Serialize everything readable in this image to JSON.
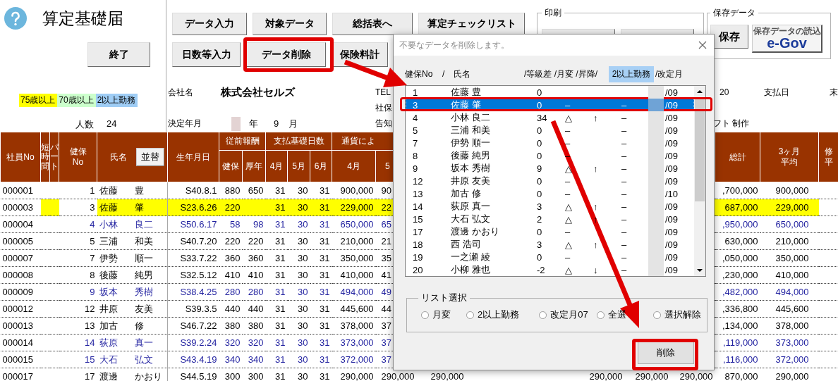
{
  "app": {
    "title": "算定基礎届",
    "exit_button": "終了",
    "legend": [
      {
        "label": "75歳以上",
        "color": "#ffff00"
      },
      {
        "label": "70歳以上",
        "color": "#ccffcc"
      },
      {
        "label": "2以上勤務",
        "color": "#9fcdf5"
      }
    ],
    "headcount_label": "人数",
    "headcount": "24"
  },
  "toolbar": {
    "rows": [
      [
        "データ入力",
        "対象データ",
        "総括表へ",
        "算定チェックリスト"
      ],
      [
        "日数等入力",
        "データ削除",
        "保険料計"
      ]
    ]
  },
  "print_group": {
    "title": "印刷"
  },
  "save_group": {
    "title": "保存データ",
    "save_button": "保存",
    "load_caption": "保存データの読込",
    "load_logo": "e-Gov"
  },
  "info": {
    "company_label": "会社名",
    "company_name": "株式会社セルズ",
    "tel_label": "TEL",
    "shaho_label": "社保",
    "decision_label": "決定年月",
    "year_label": "年",
    "month": "9",
    "month_label": "月",
    "notice_label": "告知",
    "column_20": "20",
    "payday_label": "支払日",
    "payday_value": "末",
    "credit": "フト 制作"
  },
  "table": {
    "leading_columns": [
      "社員No",
      "短時間",
      "パート",
      "健保\nNo",
      "氏名",
      "生年月日"
    ],
    "sort_button": "並替",
    "groups": [
      {
        "label": "従前報酬",
        "columns": [
          "健保",
          "厚年"
        ]
      },
      {
        "label": "支払基礎日数",
        "columns": [
          "4月",
          "5月",
          "6月"
        ]
      },
      {
        "label": "通貨によ",
        "columns": [
          "4月",
          "5"
        ]
      }
    ],
    "trailing_columns": [
      "総計",
      "3ヶ月平均",
      "修平"
    ],
    "rows": [
      {
        "employee_no": "000001",
        "kenpo_no": "1",
        "surname": "佐藤",
        "given_name": "豊",
        "birth_date": "S40.8.1",
        "prev_kenpo": "880",
        "prev_kounen": "650",
        "days_apr": "31",
        "days_may": "30",
        "days_jun": "31",
        "pay_apr": "900,000",
        "pay_may": "90",
        "total": ",700,000",
        "average": "900,000",
        "highlight": false,
        "color": "#000000"
      },
      {
        "employee_no": "000003",
        "kenpo_no": "3",
        "surname": "佐藤",
        "given_name": "肇",
        "birth_date": "S23.6.26",
        "prev_kenpo": "220",
        "days_apr": "31",
        "days_may": "30",
        "days_jun": "31",
        "pay_apr": "229,000",
        "pay_may": "22",
        "total": "687,000",
        "average": "229,000",
        "highlight": true,
        "color": "#000000"
      },
      {
        "employee_no": "000004",
        "kenpo_no": "4",
        "surname": "小林",
        "given_name": "良二",
        "birth_date": "S50.6.17",
        "prev_kenpo": "58",
        "prev_kounen": "98",
        "days_apr": "31",
        "days_may": "30",
        "days_jun": "31",
        "pay_apr": "650,000",
        "pay_may": "65",
        "total": ",950,000",
        "average": "650,000",
        "highlight": false,
        "color": "#1f1f9f"
      },
      {
        "employee_no": "000005",
        "kenpo_no": "5",
        "surname": "三浦",
        "given_name": "和美",
        "birth_date": "S40.7.20",
        "prev_kenpo": "220",
        "prev_kounen": "220",
        "days_apr": "31",
        "days_may": "30",
        "days_jun": "31",
        "pay_apr": "210,000",
        "pay_may": "21",
        "total": "630,000",
        "average": "210,000",
        "highlight": false,
        "color": "#000000"
      },
      {
        "employee_no": "000007",
        "kenpo_no": "7",
        "surname": "伊勢",
        "given_name": "順一",
        "birth_date": "S33.7.22",
        "prev_kenpo": "360",
        "prev_kounen": "360",
        "days_apr": "31",
        "days_may": "30",
        "days_jun": "31",
        "pay_apr": "350,000",
        "pay_may": "35",
        "total": ",050,000",
        "average": "350,000",
        "highlight": false,
        "color": "#000000"
      },
      {
        "employee_no": "000008",
        "kenpo_no": "8",
        "surname": "後藤",
        "given_name": "純男",
        "birth_date": "S32.5.12",
        "prev_kenpo": "410",
        "prev_kounen": "410",
        "days_apr": "31",
        "days_may": "30",
        "days_jun": "31",
        "pay_apr": "410,000",
        "pay_may": "41",
        "total": ",230,000",
        "average": "410,000",
        "highlight": false,
        "color": "#000000"
      },
      {
        "employee_no": "000009",
        "kenpo_no": "9",
        "surname": "坂本",
        "given_name": "秀樹",
        "birth_date": "S38.4.25",
        "prev_kenpo": "280",
        "prev_kounen": "280",
        "days_apr": "31",
        "days_may": "30",
        "days_jun": "31",
        "pay_apr": "494,000",
        "pay_may": "49",
        "total": ",482,000",
        "average": "494,000",
        "highlight": false,
        "color": "#1f1f9f"
      },
      {
        "employee_no": "000012",
        "kenpo_no": "12",
        "surname": "井原",
        "given_name": "友美",
        "birth_date": "S39.3.5",
        "prev_kenpo": "440",
        "prev_kounen": "440",
        "days_apr": "31",
        "days_may": "30",
        "days_jun": "31",
        "pay_apr": "445,600",
        "pay_may": "44",
        "total": ",336,800",
        "average": "445,600",
        "highlight": false,
        "color": "#000000"
      },
      {
        "employee_no": "000013",
        "kenpo_no": "13",
        "surname": "加古",
        "given_name": "修",
        "birth_date": "S46.7.22",
        "prev_kenpo": "380",
        "prev_kounen": "380",
        "days_apr": "31",
        "days_may": "30",
        "days_jun": "31",
        "pay_apr": "378,000",
        "pay_may": "37",
        "total": ",134,000",
        "average": "378,000",
        "highlight": false,
        "color": "#000000"
      },
      {
        "employee_no": "000014",
        "kenpo_no": "14",
        "surname": "荻原",
        "given_name": "真一",
        "birth_date": "S39.2.24",
        "prev_kenpo": "320",
        "prev_kounen": "320",
        "days_apr": "31",
        "days_may": "30",
        "days_jun": "31",
        "pay_apr": "373,000",
        "pay_may": "37",
        "total": ",119,000",
        "average": "373,000",
        "highlight": false,
        "color": "#1f1f9f"
      },
      {
        "employee_no": "000015",
        "kenpo_no": "15",
        "surname": "大石",
        "given_name": "弘文",
        "birth_date": "S43.4.19",
        "prev_kenpo": "340",
        "prev_kounen": "340",
        "days_apr": "31",
        "days_may": "30",
        "days_jun": "31",
        "pay_apr": "372,000",
        "pay_may": "37",
        "total": ",116,000",
        "average": "372,000",
        "highlight": false,
        "color": "#1f1f9f"
      },
      {
        "employee_no": "000017",
        "kenpo_no": "17",
        "surname": "渡邊",
        "given_name": "かおり",
        "birth_date": "S44.5.19",
        "prev_kenpo": "300",
        "prev_kounen": "300",
        "days_apr": "31",
        "days_may": "30",
        "days_jun": "31",
        "pay_apr": "290,000",
        "pay_may": "290,000",
        "pay_jun": "290,000",
        "column_16": "290,000",
        "column_17": "290,000",
        "column_18": "290,000",
        "total": "870,000",
        "average": "290,000",
        "highlight": false,
        "color": "#000000"
      }
    ]
  },
  "dialog": {
    "title": "不要なデータを削除します。",
    "columns": [
      {
        "label": "健保No",
        "highlighted": false
      },
      {
        "label": "/",
        "highlighted": false
      },
      {
        "label": "氏名",
        "highlighted": false
      },
      {
        "label": "/等級差 /月変 /昇降/",
        "highlighted": false
      },
      {
        "label": "2以上勤務",
        "highlighted": true
      },
      {
        "label": "/改定月",
        "highlighted": false
      }
    ],
    "rows": [
      {
        "no": "1",
        "name": "佐藤 豊",
        "grade": "0",
        "month": "/09",
        "selected": false
      },
      {
        "no": "3",
        "name": "佐藤 肇",
        "grade": "0",
        "change": "–",
        "multi": "–",
        "month": "/09",
        "selected": true
      },
      {
        "no": "4",
        "name": "小林 良二",
        "grade": "34",
        "change": "△",
        "direction": "↑",
        "multi": "–",
        "month": "/09",
        "selected": false
      },
      {
        "no": "5",
        "name": "三浦 和美",
        "grade": "0",
        "change": "–",
        "multi": "–",
        "month": "/09",
        "selected": false
      },
      {
        "no": "7",
        "name": "伊勢 順一",
        "grade": "0",
        "change": "–",
        "multi": "–",
        "month": "/09",
        "selected": false
      },
      {
        "no": "8",
        "name": "後藤 純男",
        "grade": "0",
        "change": "–",
        "multi": "–",
        "month": "/09",
        "selected": false
      },
      {
        "no": "9",
        "name": "坂本 秀樹",
        "grade": "9",
        "change": "△",
        "direction": "↑",
        "multi": "–",
        "month": "/09",
        "selected": false
      },
      {
        "no": "12",
        "name": "井原 友美",
        "grade": "0",
        "change": "–",
        "multi": "–",
        "month": "/09",
        "selected": false
      },
      {
        "no": "13",
        "name": "加古 修",
        "grade": "0",
        "change": "–",
        "multi": "–",
        "month": "/10",
        "selected": false
      },
      {
        "no": "14",
        "name": "荻原 真一",
        "grade": "3",
        "change": "△",
        "direction": "↑",
        "multi": "–",
        "month": "/09",
        "selected": false
      },
      {
        "no": "15",
        "name": "大石 弘文",
        "grade": "2",
        "change": "△",
        "direction": "↑",
        "multi": "–",
        "month": "/09",
        "selected": false
      },
      {
        "no": "17",
        "name": "渡邊 かおり",
        "grade": "0",
        "change": "–",
        "multi": "–",
        "month": "/09",
        "selected": false
      },
      {
        "no": "18",
        "name": "西 浩司",
        "grade": "3",
        "change": "△",
        "direction": "↑",
        "multi": "–",
        "month": "/09",
        "selected": false
      },
      {
        "no": "19",
        "name": "一之瀬 綾",
        "grade": "0",
        "change": "–",
        "multi": "–",
        "month": "/09",
        "selected": false
      },
      {
        "no": "20",
        "name": "小柳 雅也",
        "grade": "-2",
        "change": "△",
        "direction": "↓",
        "multi": "–",
        "month": "/09",
        "selected": false
      }
    ],
    "list_select": {
      "title": "リスト選択",
      "options": [
        {
          "label": "月変",
          "selected": false
        },
        {
          "label": "2以上勤務",
          "selected": false
        },
        {
          "label": "改定月07",
          "selected": false
        },
        {
          "label": "全選",
          "selected": false
        },
        {
          "label": "選択解除",
          "selected": false
        }
      ]
    },
    "delete_button": "削除"
  }
}
